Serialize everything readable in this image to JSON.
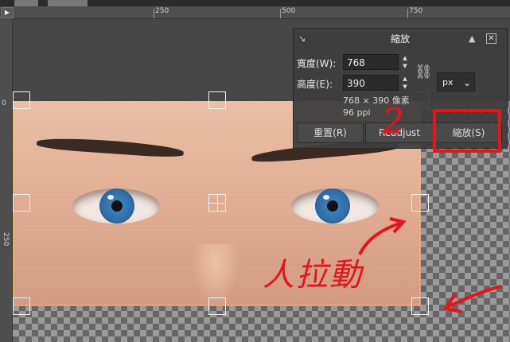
{
  "ruler": {
    "h_labels": [
      "250",
      "500",
      "750"
    ],
    "v_labels": [
      "0",
      "250"
    ]
  },
  "nav": {
    "button": "▶"
  },
  "dialog": {
    "title": "縮放",
    "width_label": "寬度(W):",
    "width_value": "768",
    "height_label": "高度(E):",
    "height_value": "390",
    "unit": "px",
    "size_info": "768 × 390 像素",
    "ppi_info": "96 ppi",
    "reset_button": "重置(R)",
    "readjust_button": "Readjust",
    "scale_button": "縮放(S)"
  },
  "annotations": {
    "drag_text": "人拉動",
    "step_number": "2"
  },
  "colors": {
    "annotation_red": "#e8141c",
    "selection_dash": "#d8c36a"
  }
}
